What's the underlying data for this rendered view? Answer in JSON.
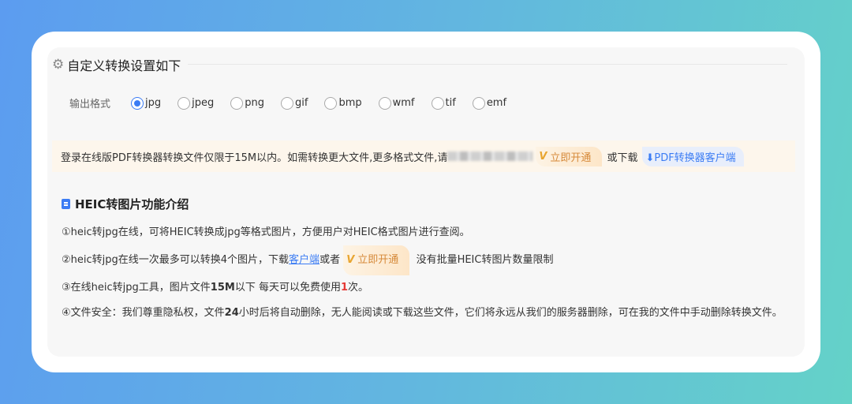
{
  "settings": {
    "title": "自定义转换设置如下",
    "format_label": "输出格式",
    "formats": [
      {
        "label": "jpg",
        "selected": true
      },
      {
        "label": "jpeg"
      },
      {
        "label": "png"
      },
      {
        "label": "gif"
      },
      {
        "label": "bmp"
      },
      {
        "label": "wmf"
      },
      {
        "label": "tif"
      },
      {
        "label": "emf"
      }
    ]
  },
  "notice": {
    "text": "登录在线版PDF转换器转换文件仅限于15M以内。如需转换更大文件,更多格式文件,请",
    "vip_label": "立即开通",
    "vip_icon": "V",
    "or_download": "或下载",
    "client_label": "PDF转换器客户端"
  },
  "intro": {
    "title": "HEIC转图片功能介绍",
    "p1": "①heic转jpg在线，可将HEIC转换成jpg等格式图片，方便用户对HEIC格式图片进行查阅。",
    "p2a": "②heic转jpg在线一次最多可以转换4个图片，下载",
    "p2link": "客户端",
    "p2b": "或者",
    "p2vip": "立即开通",
    "p2c": "没有批量HEIC转图片数量限制",
    "p3a": "③在线heic转jpg工具，图片文件",
    "p3b": "15M",
    "p3c": "以下 每天可以免费使用",
    "p3d": "1",
    "p3e": "次。",
    "p4a": "④文件安全：我们尊重隐私权，文件",
    "p4b": "24",
    "p4c": "小时后将自动删除，无人能阅读或下载这些文件，它们将永远从我们的服务器删除，可在我的文件中手动删除转换文件。"
  }
}
